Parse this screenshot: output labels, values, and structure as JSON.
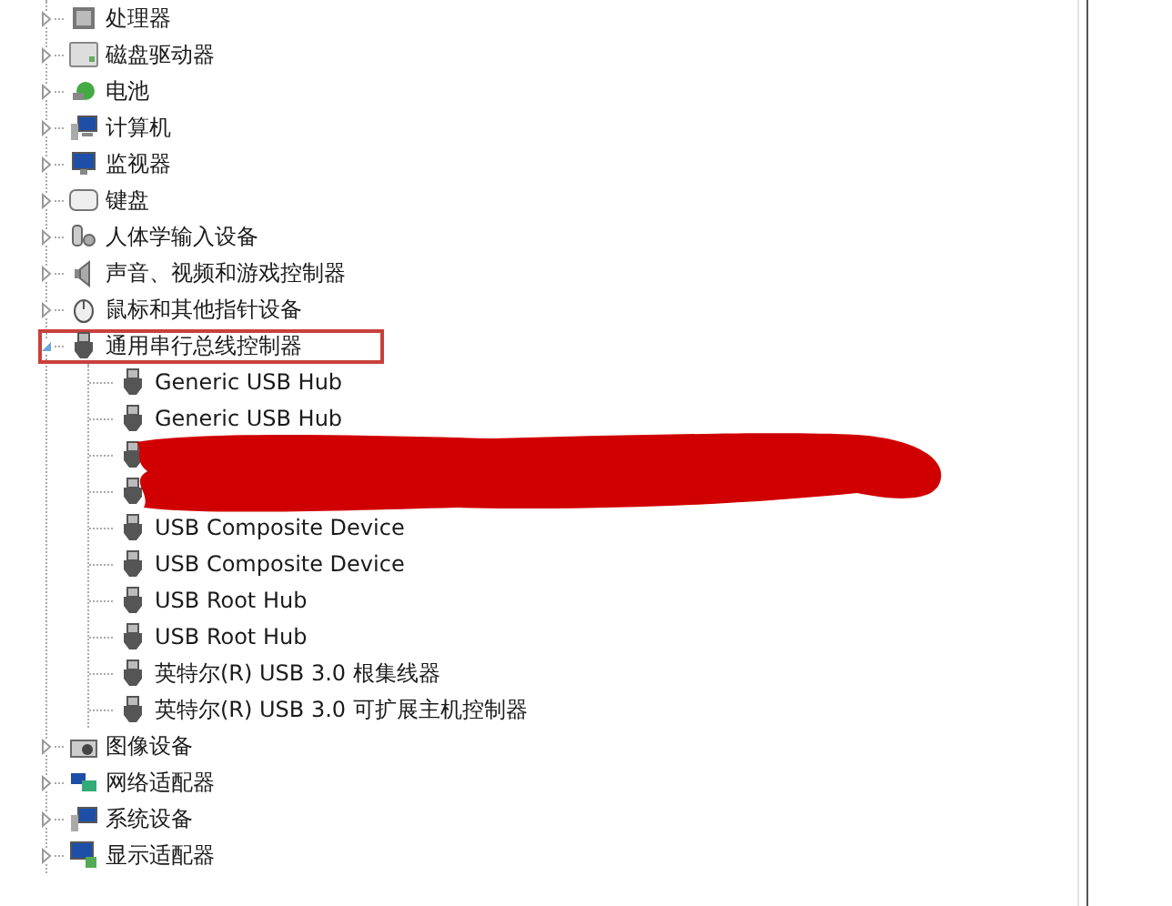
{
  "tree": [
    {
      "label": "处理器",
      "expanded": false
    },
    {
      "label": "磁盘驱动器",
      "expanded": false
    },
    {
      "label": "电池",
      "expanded": false
    },
    {
      "label": "计算机",
      "expanded": false
    },
    {
      "label": "监视器",
      "expanded": false
    },
    {
      "label": "键盘",
      "expanded": false
    },
    {
      "label": "人体学输入设备",
      "expanded": false
    },
    {
      "label": "声音、视频和游戏控制器",
      "expanded": false
    },
    {
      "label": "鼠标和其他指针设备",
      "expanded": false
    },
    {
      "label": "通用串行总线控制器",
      "expanded": true,
      "highlighted": true,
      "children": [
        {
          "label": "Generic USB Hub"
        },
        {
          "label": "Generic USB Hub"
        },
        {
          "redacted": true
        },
        {
          "redacted": true
        },
        {
          "label": "USB Composite Device"
        },
        {
          "label": "USB Composite Device"
        },
        {
          "label": "USB Root Hub"
        },
        {
          "label": "USB Root Hub"
        },
        {
          "label": "英特尔(R) USB 3.0 根集线器"
        },
        {
          "label": "英特尔(R) USB 3.0 可扩展主机控制器"
        }
      ]
    },
    {
      "label": "图像设备",
      "expanded": false
    },
    {
      "label": "网络适配器",
      "expanded": false
    },
    {
      "label": "系统设备",
      "expanded": false
    },
    {
      "label": "显示适配器",
      "expanded": false
    }
  ]
}
